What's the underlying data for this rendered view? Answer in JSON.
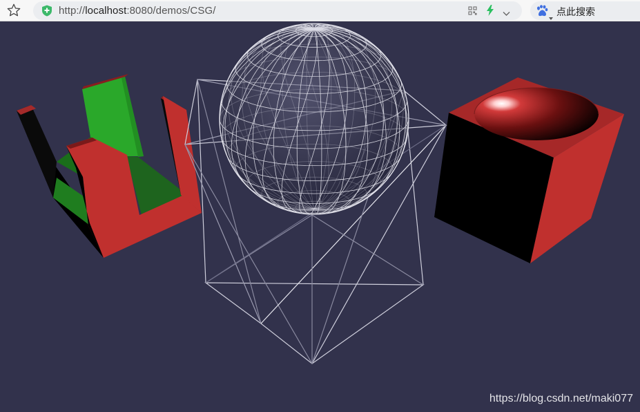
{
  "browser": {
    "url_scheme": "http://",
    "url_host": "localhost",
    "url_rest": ":8080/demos/CSG/",
    "bookmark_icon": "star-icon",
    "security_icon": "shield-plus-icon",
    "qr_icon": "qr-code-icon",
    "speed_icon": "lightning-icon",
    "dropdown_icon": "chevron-down-icon",
    "search_engine_icon": "baidu-paw-icon",
    "search_placeholder": "点此搜索"
  },
  "scene": {
    "background_color": "#32324c",
    "objects": [
      "csg-subtracted-cube-red-green",
      "wireframe-sphere",
      "wireframe-cube",
      "cube-with-hemispherical-cavity"
    ],
    "colors": {
      "red": "#c0302e",
      "green": "#2aa82a",
      "wire": "#d8d8e0"
    }
  },
  "watermark": "https://blog.csdn.net/maki077"
}
